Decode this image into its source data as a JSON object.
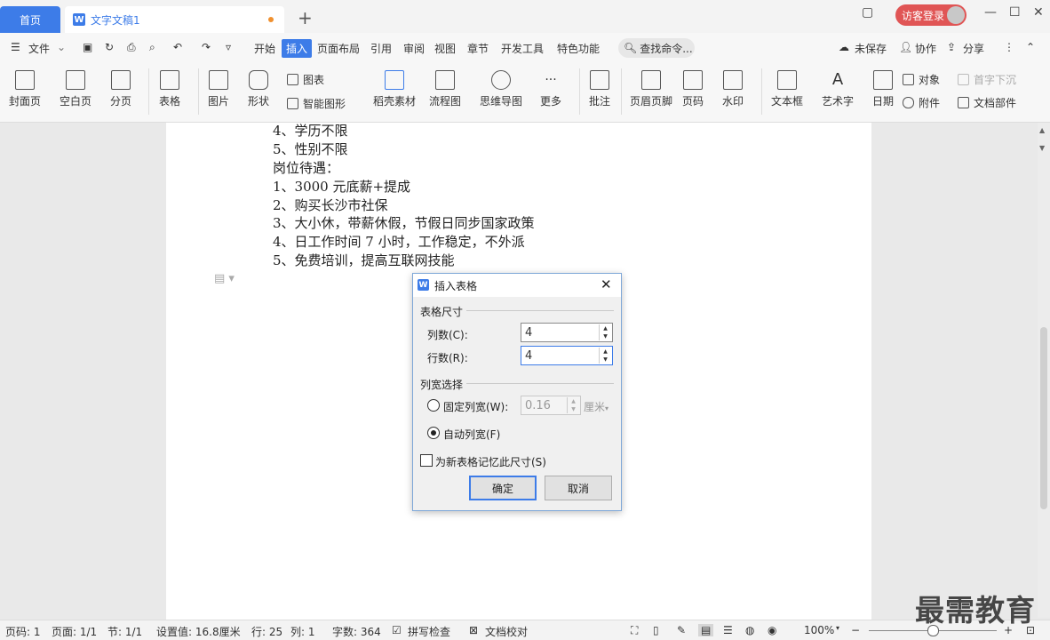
{
  "titlebar": {
    "home_tab": "首页",
    "doc_tab": "文字文稿1",
    "doc_icon": "W",
    "new_tab_icon": "+",
    "login": "访客登录"
  },
  "menubar": {
    "file": "文件",
    "items": [
      "开始",
      "插入",
      "页面布局",
      "引用",
      "审阅",
      "视图",
      "章节",
      "开发工具",
      "特色功能"
    ],
    "active": "插入",
    "search": "查找命令...",
    "unsaved": "未保存",
    "collab": "协作",
    "share": "分享"
  },
  "ribbon": {
    "buttons": [
      "封面页",
      "空白页",
      "分页",
      "表格",
      "图片",
      "形状",
      "稻壳素材",
      "流程图",
      "思维导图",
      "更多",
      "批注",
      "页眉页脚",
      "页码",
      "水印",
      "文本框",
      "艺术字",
      "日期"
    ],
    "small": {
      "chart": "图表",
      "smartart": "智能图形",
      "object": "对象",
      "dropcap": "首字下沉",
      "attach": "附件",
      "docparts": "文档部件"
    }
  },
  "document": {
    "lines": [
      "4、学历不限",
      "5、性别不限",
      "岗位待遇：",
      "1、3000 元底薪+提成",
      "2、购买长沙市社保",
      "3、大小休，带薪休假，节假日同步国家政策",
      "4、日工作时间 7 小时，工作稳定，不外派",
      "5、免费培训，提高互联网技能"
    ]
  },
  "dialog": {
    "title": "插入表格",
    "section_size": "表格尺寸",
    "cols_label": "列数(C):",
    "cols_value": "4",
    "rows_label": "行数(R):",
    "rows_value": "4",
    "section_width": "列宽选择",
    "fixed_label": "固定列宽(W):",
    "fixed_value": "0.16",
    "unit": "厘米",
    "auto_label": "自动列宽(F)",
    "remember_label": "为新表格记忆此尺寸(S)",
    "ok": "确定",
    "cancel": "取消"
  },
  "statusbar": {
    "page_num": "页码: 1",
    "pages": "页面: 1/1",
    "section": "节: 1/1",
    "setting": "设置值: 16.8厘米",
    "row": "行: 25",
    "col": "列: 1",
    "words": "字数: 364",
    "spell": "拼写检查",
    "proof": "文档校对",
    "zoom": "100%"
  },
  "watermark": "最需教育"
}
